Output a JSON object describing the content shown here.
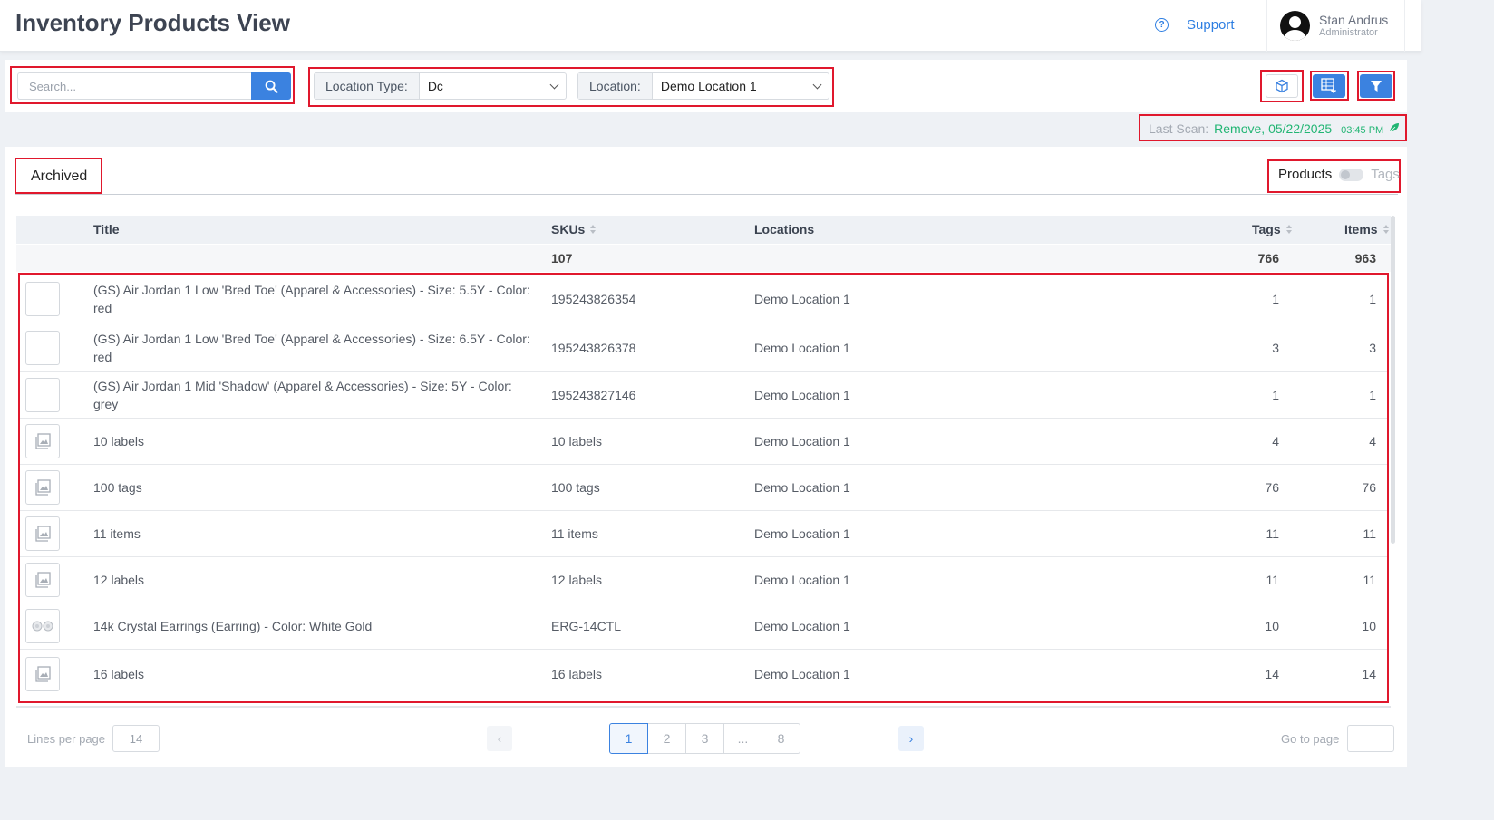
{
  "header": {
    "title": "Inventory Products View",
    "support_label": "Support",
    "user": {
      "name": "Stan Andrus",
      "role": "Administrator"
    }
  },
  "toolbar": {
    "search_placeholder": "Search...",
    "location_type": {
      "label": "Location Type:",
      "value": "Dc"
    },
    "location": {
      "label": "Location:",
      "value": "Demo Location 1"
    },
    "actions": [
      "box-icon",
      "excel-export-icon",
      "filter-icon"
    ],
    "accent_color": "#3b82e0"
  },
  "last_scan": {
    "label": "Last Scan:",
    "value": "Remove, 05/22/2025",
    "time": "03:45 PM",
    "status_color": "#21b573"
  },
  "tabs": {
    "archived": "Archived"
  },
  "view_toggle": {
    "products": "Products",
    "tags": "Tags",
    "state": "products"
  },
  "table": {
    "columns": {
      "title": "Title",
      "skus": "SKUs",
      "locations": "Locations",
      "tags": "Tags",
      "items": "Items"
    },
    "totals": {
      "skus": "107",
      "tags": "766",
      "items": "963"
    },
    "rows": [
      {
        "thumb": "blank",
        "title": "(GS) Air Jordan 1 Low 'Bred Toe' (Apparel & Accessories) - Size: 5.5Y - Color: red",
        "sku": "195243826354",
        "location": "Demo Location 1",
        "tags": "1",
        "items": "1"
      },
      {
        "thumb": "blank",
        "title": "(GS) Air Jordan 1 Low 'Bred Toe' (Apparel & Accessories) - Size: 6.5Y - Color: red",
        "sku": "195243826378",
        "location": "Demo Location 1",
        "tags": "3",
        "items": "3"
      },
      {
        "thumb": "blank",
        "title": "(GS) Air Jordan 1 Mid 'Shadow' (Apparel & Accessories) - Size: 5Y - Color: grey",
        "sku": "195243827146",
        "location": "Demo Location 1",
        "tags": "1",
        "items": "1"
      },
      {
        "thumb": "image",
        "title": "10 labels",
        "sku": "10 labels",
        "location": "Demo Location 1",
        "tags": "4",
        "items": "4"
      },
      {
        "thumb": "image",
        "title": "100 tags",
        "sku": "100 tags",
        "location": "Demo Location 1",
        "tags": "76",
        "items": "76"
      },
      {
        "thumb": "image",
        "title": "11 items",
        "sku": "11 items",
        "location": "Demo Location 1",
        "tags": "11",
        "items": "11"
      },
      {
        "thumb": "image",
        "title": "12 labels",
        "sku": "12 labels",
        "location": "Demo Location 1",
        "tags": "11",
        "items": "11"
      },
      {
        "thumb": "earring",
        "title": "14k Crystal Earrings (Earring) - Color: White Gold",
        "sku": "ERG-14CTL",
        "location": "Demo Location 1",
        "tags": "10",
        "items": "10"
      },
      {
        "thumb": "image",
        "title": "16 labels",
        "sku": "16 labels",
        "location": "Demo Location 1",
        "tags": "14",
        "items": "14"
      }
    ]
  },
  "pagination": {
    "lines_per_page_label": "Lines per page",
    "lines_per_page": "14",
    "prev": "‹",
    "next": "›",
    "pages": [
      "1",
      "2",
      "3",
      "...",
      "8"
    ],
    "current": "1",
    "goto_label": "Go to page"
  }
}
